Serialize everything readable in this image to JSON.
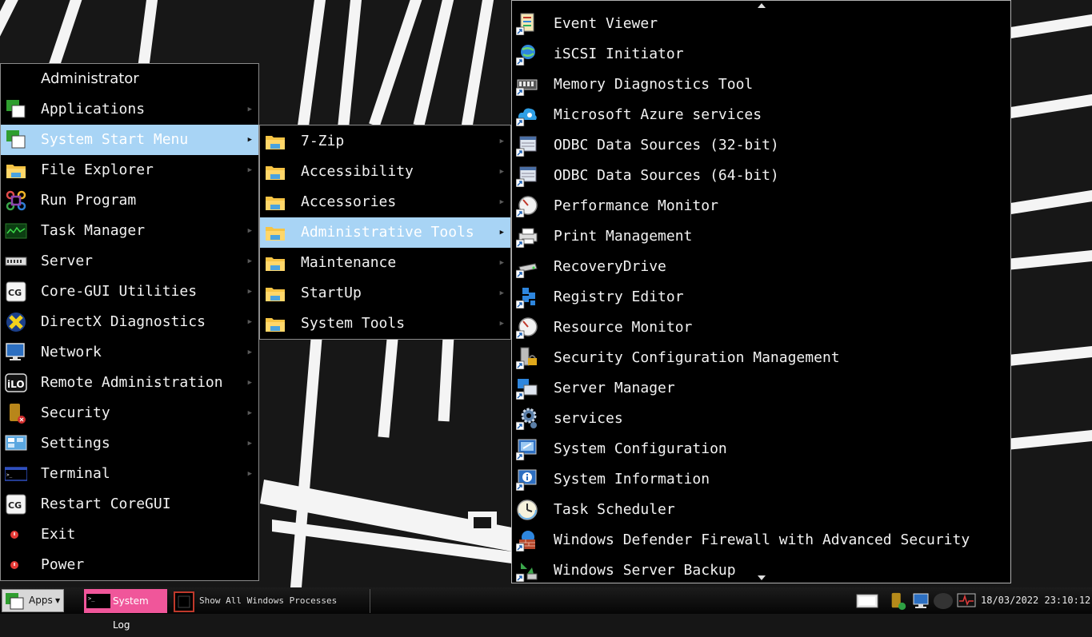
{
  "main_menu": {
    "header": "Administrator",
    "items": [
      {
        "label": "Applications",
        "icon": "windows-stack-icon",
        "arrow": true
      },
      {
        "label": "System Start Menu",
        "icon": "windows-stack-icon",
        "arrow": true,
        "highlighted": true
      },
      {
        "label": "File Explorer",
        "icon": "folder-icon",
        "arrow": true
      },
      {
        "label": "Run Program",
        "icon": "command-key-icon",
        "arrow": false
      },
      {
        "label": "Task Manager",
        "icon": "monitor-graph-icon",
        "arrow": true
      },
      {
        "label": "Server",
        "icon": "server-rack-icon",
        "arrow": true
      },
      {
        "label": "Core-GUI Utilities",
        "icon": "coregui-icon",
        "arrow": true
      },
      {
        "label": "DirectX Diagnostics",
        "icon": "directx-icon",
        "arrow": true
      },
      {
        "label": "Network",
        "icon": "network-monitor-icon",
        "arrow": true
      },
      {
        "label": "Remote Administration",
        "icon": "ilo-icon",
        "arrow": true
      },
      {
        "label": "Security",
        "icon": "shield-icon",
        "arrow": true
      },
      {
        "label": "Settings",
        "icon": "control-panel-icon",
        "arrow": true
      },
      {
        "label": "Terminal",
        "icon": "terminal-icon",
        "arrow": true
      },
      {
        "label": "Restart CoreGUI",
        "icon": "coregui-icon",
        "arrow": false
      },
      {
        "label": "Exit",
        "icon": "power-red-icon",
        "arrow": false
      },
      {
        "label": "Power",
        "icon": "power-red-icon",
        "arrow": false
      }
    ]
  },
  "sub_menu": {
    "items": [
      {
        "label": "7-Zip",
        "icon": "folder-icon"
      },
      {
        "label": "Accessibility",
        "icon": "folder-icon"
      },
      {
        "label": "Accessories",
        "icon": "folder-icon"
      },
      {
        "label": "Administrative Tools",
        "icon": "folder-icon",
        "highlighted": true
      },
      {
        "label": "Maintenance",
        "icon": "folder-icon"
      },
      {
        "label": "StartUp",
        "icon": "folder-icon"
      },
      {
        "label": "System Tools",
        "icon": "folder-icon"
      }
    ]
  },
  "admin_tools": {
    "items": [
      {
        "label": "Event Viewer",
        "icon": "event-viewer-icon"
      },
      {
        "label": "iSCSI Initiator",
        "icon": "globe-icon"
      },
      {
        "label": "Memory Diagnostics Tool",
        "icon": "memory-chip-icon"
      },
      {
        "label": "Microsoft Azure services",
        "icon": "azure-cloud-icon"
      },
      {
        "label": "ODBC Data Sources (32-bit)",
        "icon": "database-icon"
      },
      {
        "label": "ODBC Data Sources (64-bit)",
        "icon": "database-icon"
      },
      {
        "label": "Performance Monitor",
        "icon": "gauge-icon"
      },
      {
        "label": "Print Management",
        "icon": "printer-icon"
      },
      {
        "label": "RecoveryDrive",
        "icon": "drive-icon"
      },
      {
        "label": "Registry Editor",
        "icon": "registry-icon"
      },
      {
        "label": "Resource Monitor",
        "icon": "gauge-icon"
      },
      {
        "label": "Security Configuration Management",
        "icon": "lock-server-icon"
      },
      {
        "label": "Server Manager",
        "icon": "server-manager-icon"
      },
      {
        "label": "services",
        "icon": "gears-icon"
      },
      {
        "label": "System Configuration",
        "icon": "system-config-icon"
      },
      {
        "label": "System Information",
        "icon": "info-icon"
      },
      {
        "label": "Task Scheduler",
        "icon": "clock-icon"
      },
      {
        "label": "Windows Defender Firewall with Advanced Security",
        "icon": "firewall-icon"
      },
      {
        "label": "Windows Server Backup",
        "icon": "backup-icon"
      }
    ]
  },
  "taskbar": {
    "apps_label": "Apps",
    "tasks": [
      {
        "label": "System Log",
        "active": true
      },
      {
        "label": "Show All Windows Processes",
        "active": false
      }
    ],
    "clock": "18/03/2022 23:10:12"
  }
}
